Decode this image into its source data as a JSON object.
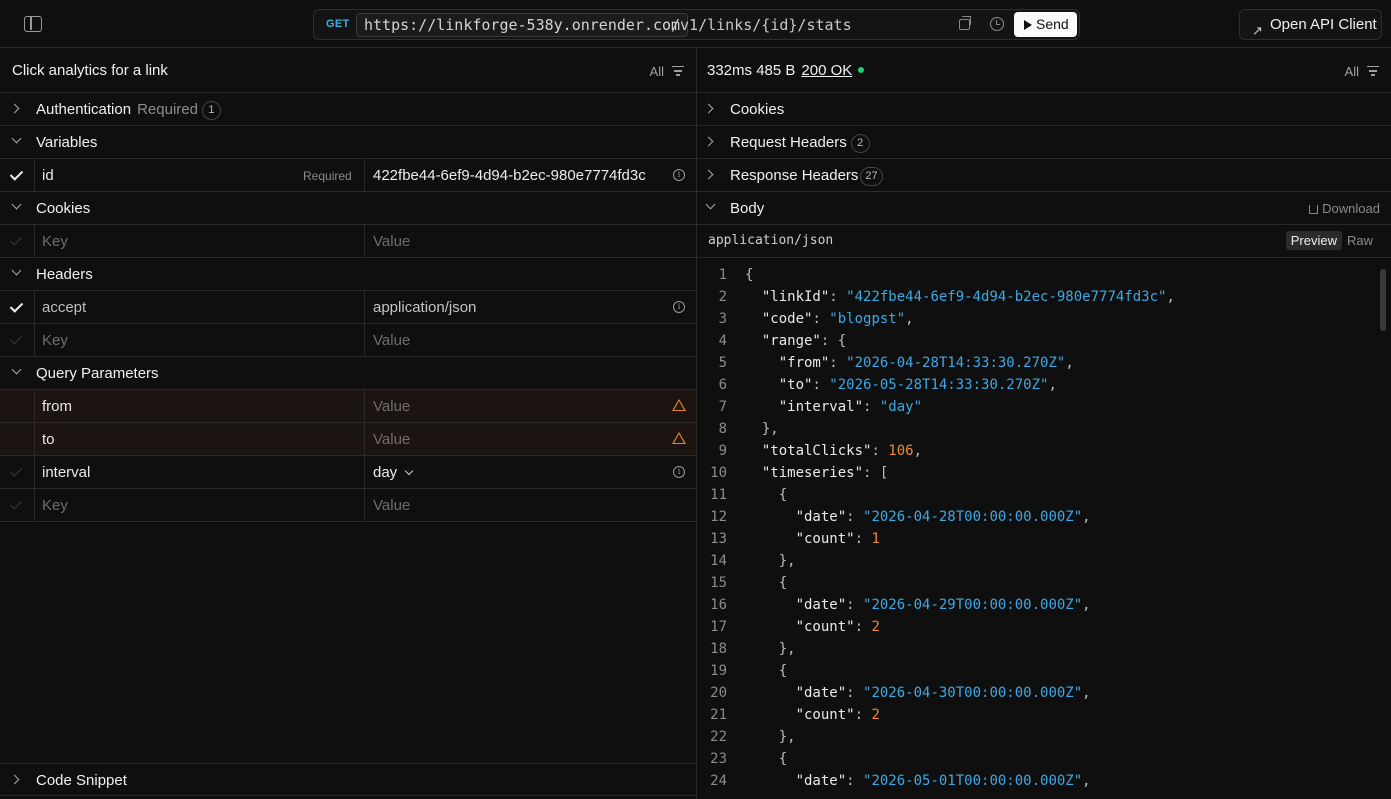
{
  "topbar": {
    "method": "GET",
    "server": "https://linkforge-538y.onrender.com",
    "path": "/v1/links/{id}/stats",
    "send_label": "Send",
    "open_client_label": "Open API Client"
  },
  "request": {
    "title": "Click analytics for a link",
    "filter_label": "All",
    "auth": {
      "label": "Authentication",
      "sub": "Required",
      "count": "1"
    },
    "variables": {
      "label": "Variables",
      "rows": [
        {
          "key": "id",
          "required": "Required",
          "value": "422fbe44-6ef9-4d94-b2ec-980e7774fd3c"
        }
      ]
    },
    "cookies": {
      "label": "Cookies",
      "key_placeholder": "Key",
      "value_placeholder": "Value"
    },
    "headers": {
      "label": "Headers",
      "rows": [
        {
          "key": "accept",
          "value": "application/json"
        }
      ],
      "key_placeholder": "Key",
      "value_placeholder": "Value"
    },
    "query": {
      "label": "Query Parameters",
      "rows": [
        {
          "key": "from",
          "value_placeholder": "Value"
        },
        {
          "key": "to",
          "value_placeholder": "Value"
        },
        {
          "key": "interval",
          "value": "day"
        }
      ],
      "key_placeholder": "Key",
      "value_placeholder": "Value"
    },
    "code_snippet_label": "Code Snippet"
  },
  "response": {
    "time": "332ms",
    "size": "485 B",
    "status": "200 OK",
    "status_color": "#1fd16b",
    "filter_label": "All",
    "sections": {
      "cookies": "Cookies",
      "request_headers": "Request Headers",
      "request_headers_count": "2",
      "response_headers": "Response Headers",
      "response_headers_count": "27",
      "body": "Body",
      "download": "Download"
    },
    "content_type": "application/json",
    "preview_label": "Preview",
    "raw_label": "Raw",
    "lines": [
      {
        "n": "1",
        "tokens": [
          [
            "p",
            "{"
          ]
        ]
      },
      {
        "n": "2",
        "tokens": [
          [
            "k",
            "  \"linkId\""
          ],
          [
            "p",
            ": "
          ],
          [
            "s",
            "\"422fbe44-6ef9-4d94-b2ec-980e7774fd3c\""
          ],
          [
            "p",
            ","
          ]
        ]
      },
      {
        "n": "3",
        "tokens": [
          [
            "k",
            "  \"code\""
          ],
          [
            "p",
            ": "
          ],
          [
            "s",
            "\"blogpst\""
          ],
          [
            "p",
            ","
          ]
        ]
      },
      {
        "n": "4",
        "tokens": [
          [
            "k",
            "  \"range\""
          ],
          [
            "p",
            ": {"
          ]
        ]
      },
      {
        "n": "5",
        "tokens": [
          [
            "k",
            "    \"from\""
          ],
          [
            "p",
            ": "
          ],
          [
            "s",
            "\"2026-04-28T14:33:30.270Z\""
          ],
          [
            "p",
            ","
          ]
        ]
      },
      {
        "n": "6",
        "tokens": [
          [
            "k",
            "    \"to\""
          ],
          [
            "p",
            ": "
          ],
          [
            "s",
            "\"2026-05-28T14:33:30.270Z\""
          ],
          [
            "p",
            ","
          ]
        ]
      },
      {
        "n": "7",
        "tokens": [
          [
            "k",
            "    \"interval\""
          ],
          [
            "p",
            ": "
          ],
          [
            "s",
            "\"day\""
          ]
        ]
      },
      {
        "n": "8",
        "tokens": [
          [
            "p",
            "  },"
          ]
        ]
      },
      {
        "n": "9",
        "tokens": [
          [
            "k",
            "  \"totalClicks\""
          ],
          [
            "p",
            ": "
          ],
          [
            "n",
            "106"
          ],
          [
            "p",
            ","
          ]
        ]
      },
      {
        "n": "10",
        "tokens": [
          [
            "k",
            "  \"timeseries\""
          ],
          [
            "p",
            ": ["
          ]
        ]
      },
      {
        "n": "11",
        "tokens": [
          [
            "p",
            "    {"
          ]
        ]
      },
      {
        "n": "12",
        "tokens": [
          [
            "k",
            "      \"date\""
          ],
          [
            "p",
            ": "
          ],
          [
            "s",
            "\"2026-04-28T00:00:00.000Z\""
          ],
          [
            "p",
            ","
          ]
        ]
      },
      {
        "n": "13",
        "tokens": [
          [
            "k",
            "      \"count\""
          ],
          [
            "p",
            ": "
          ],
          [
            "n",
            "1"
          ]
        ]
      },
      {
        "n": "14",
        "tokens": [
          [
            "p",
            "    },"
          ]
        ]
      },
      {
        "n": "15",
        "tokens": [
          [
            "p",
            "    {"
          ]
        ]
      },
      {
        "n": "16",
        "tokens": [
          [
            "k",
            "      \"date\""
          ],
          [
            "p",
            ": "
          ],
          [
            "s",
            "\"2026-04-29T00:00:00.000Z\""
          ],
          [
            "p",
            ","
          ]
        ]
      },
      {
        "n": "17",
        "tokens": [
          [
            "k",
            "      \"count\""
          ],
          [
            "p",
            ": "
          ],
          [
            "n",
            "2"
          ]
        ]
      },
      {
        "n": "18",
        "tokens": [
          [
            "p",
            "    },"
          ]
        ]
      },
      {
        "n": "19",
        "tokens": [
          [
            "p",
            "    {"
          ]
        ]
      },
      {
        "n": "20",
        "tokens": [
          [
            "k",
            "      \"date\""
          ],
          [
            "p",
            ": "
          ],
          [
            "s",
            "\"2026-04-30T00:00:00.000Z\""
          ],
          [
            "p",
            ","
          ]
        ]
      },
      {
        "n": "21",
        "tokens": [
          [
            "k",
            "      \"count\""
          ],
          [
            "p",
            ": "
          ],
          [
            "n",
            "2"
          ]
        ]
      },
      {
        "n": "22",
        "tokens": [
          [
            "p",
            "    },"
          ]
        ]
      },
      {
        "n": "23",
        "tokens": [
          [
            "p",
            "    {"
          ]
        ]
      },
      {
        "n": "24",
        "tokens": [
          [
            "k",
            "      \"date\""
          ],
          [
            "p",
            ": "
          ],
          [
            "s",
            "\"2026-05-01T00:00:00.000Z\""
          ],
          [
            "p",
            ","
          ]
        ]
      }
    ]
  },
  "icons": {
    "sidebar_toggle": "sidebar-toggle-icon",
    "copy": "copy-icon",
    "history": "history-icon",
    "play": "play-icon",
    "external": "external-link-icon",
    "filter": "filter-icon",
    "info": "info-icon",
    "warning": "warning-icon",
    "download": "download-icon"
  }
}
